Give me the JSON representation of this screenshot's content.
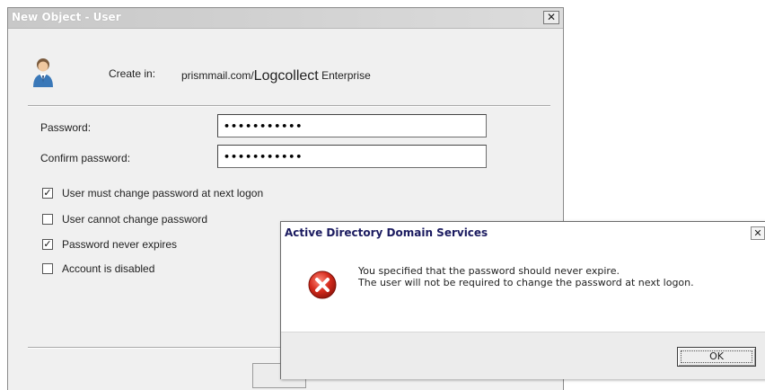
{
  "main_dialog": {
    "title": "New Object - User",
    "close_glyph": "✕",
    "create_in_label": "Create in:",
    "create_in_prefix": "prismmail.com/",
    "create_in_emphasis": "Logcollect",
    "create_in_suffix": "Enterprise",
    "user_icon": "user-icon",
    "password_label": "Password:",
    "password_value": "•••••••••••",
    "confirm_label": "Confirm password:",
    "confirm_value": "•••••••••••",
    "checkboxes": [
      {
        "label": "User must change password at next logon",
        "checked": true,
        "mark": "✓"
      },
      {
        "label": "User cannot change password",
        "checked": false,
        "mark": ""
      },
      {
        "label": "Password never expires",
        "checked": true,
        "mark": "✓"
      },
      {
        "label": "Account is disabled",
        "checked": false,
        "mark": ""
      }
    ]
  },
  "alert": {
    "title": "Active Directory Domain Services",
    "close_glyph": "✕",
    "icon": "error-icon",
    "message_line1": "You specified that the password should never expire.",
    "message_line2": "The user will not be required to change the password at next logon.",
    "ok_label": "OK"
  },
  "colors": {
    "alert_title": "#1b1b60",
    "error_red": "#d42a1c",
    "window_bg": "#f0f0f0"
  }
}
